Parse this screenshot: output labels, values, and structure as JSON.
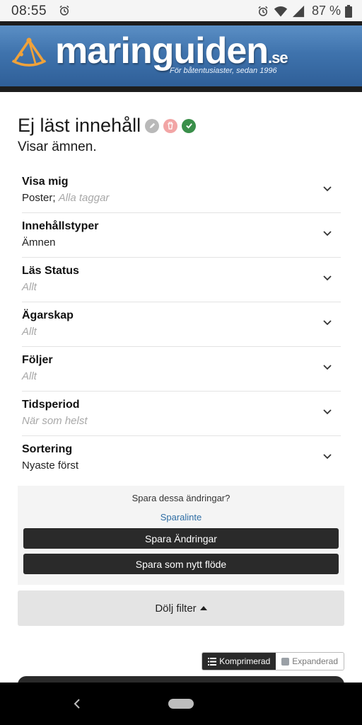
{
  "status_bar": {
    "time": "08:55",
    "battery": "87 %"
  },
  "header": {
    "logo_text": "maringuiden",
    "logo_tld": ".se",
    "tagline": "För båtentusiaster, sedan 1996"
  },
  "page": {
    "title": "Ej läst innehåll",
    "subtitle": "Visar ämnen."
  },
  "filters": [
    {
      "label": "Visa mig",
      "value": "Poster;",
      "value_muted": "Alla taggar"
    },
    {
      "label": "Innehållstyper",
      "value": "Ämnen",
      "value_muted": ""
    },
    {
      "label": "Läs Status",
      "value": "",
      "value_muted": "Allt"
    },
    {
      "label": "Ägarskap",
      "value": "",
      "value_muted": "Allt"
    },
    {
      "label": "Följer",
      "value": "",
      "value_muted": "Allt"
    },
    {
      "label": "Tidsperiod",
      "value": "",
      "value_muted": "När som helst"
    },
    {
      "label": "Sortering",
      "value": "Nyaste först",
      "value_muted": ""
    }
  ],
  "save_panel": {
    "question": "Spara dessa ändringar?",
    "link": "Sparalinte",
    "save_button": "Spara Ändringar",
    "save_new_button": "Spara som nytt flöde"
  },
  "hide_filter": {
    "label": "Dölj filter"
  },
  "view_toggle": {
    "compact": "Komprimerad",
    "expanded": "Expanderad"
  },
  "colors": {
    "accent_link": "#2e6da4",
    "button_dark": "#2a2a2a",
    "icon_edit": "#b9b9b9",
    "icon_delete": "#f2a5a5",
    "icon_done": "#3a8f4a"
  },
  "icons": [
    "alarm-icon",
    "wifi-icon",
    "signal-icon",
    "battery-icon",
    "sextant-logo-icon",
    "edit-icon",
    "delete-icon",
    "check-icon",
    "chevron-down-icon",
    "caret-up-icon",
    "list-icon",
    "square-icon",
    "back-icon",
    "home-icon"
  ]
}
